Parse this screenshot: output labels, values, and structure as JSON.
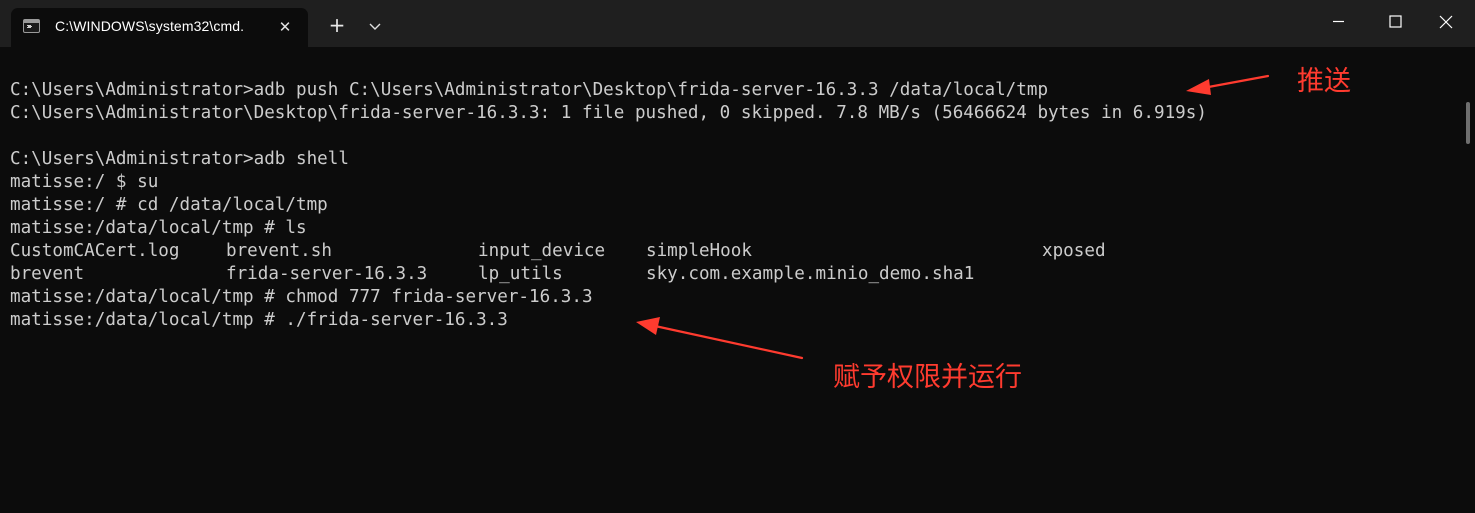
{
  "window": {
    "tab_title": "C:\\WINDOWS\\system32\\cmd.",
    "tab_close_glyph": "✕",
    "new_tab_glyph": "+",
    "controls": [
      "minimize",
      "maximize",
      "close"
    ]
  },
  "terminal": {
    "lines": [
      "C:\\Users\\Administrator>adb push C:\\Users\\Administrator\\Desktop\\frida-server-16.3.3 /data/local/tmp",
      "C:\\Users\\Administrator\\Desktop\\frida-server-16.3.3: 1 file pushed, 0 skipped. 7.8 MB/s (56466624 bytes in 6.919s)",
      "",
      "C:\\Users\\Administrator>adb shell",
      "matisse:/ $ su",
      "matisse:/ # cd /data/local/tmp",
      "matisse:/data/local/tmp # ls"
    ],
    "ls_output": {
      "row1": [
        "CustomCACert.log",
        "brevent.sh",
        "input_device",
        "simpleHook",
        "xposed"
      ],
      "row2": [
        "brevent",
        "frida-server-16.3.3",
        "lp_utils",
        "sky.com.example.minio_demo.sha1"
      ]
    },
    "after_lines": [
      "matisse:/data/local/tmp # chmod 777 frida-server-16.3.3",
      "matisse:/data/local/tmp # ./frida-server-16.3.3"
    ]
  },
  "annotations": {
    "push_label": "推送",
    "run_label": "赋予权限并运行",
    "color": "#ff3b2f"
  },
  "colors": {
    "terminal_bg": "#0c0c0c",
    "terminal_fg": "#cccccc",
    "titlebar_bg": "#1f1f1f"
  }
}
